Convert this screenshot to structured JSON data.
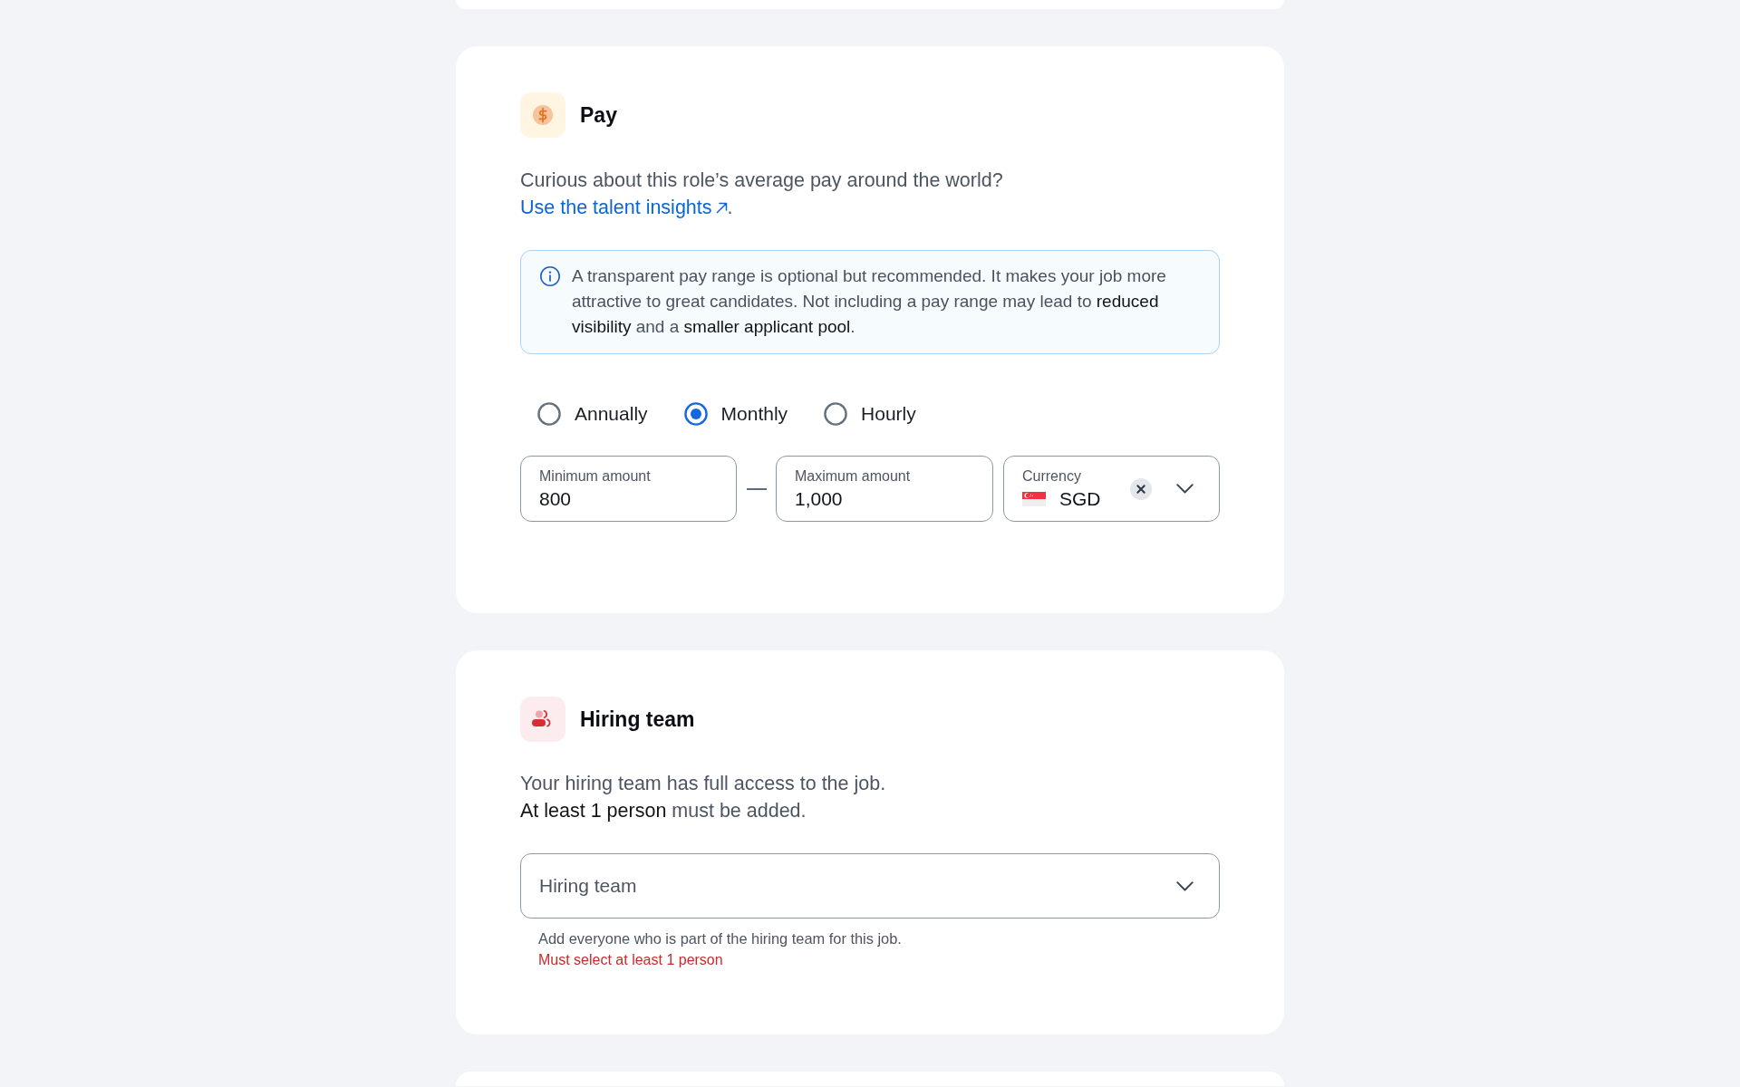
{
  "pay_section": {
    "title": "Pay",
    "description": "Curious about this role’s average pay around the world?",
    "insights_link": {
      "label": "Use the talent insights",
      "suffix": "."
    },
    "notice": "A transparent pay range is optional but recommended. It makes your job more attractive to great candidates. Not including a pay range may lead to **reduced visibility** and a **smaller applicant pool**.",
    "pay_period": [
      {
        "label": "Annually",
        "selected": false
      },
      {
        "label": "Monthly",
        "selected": true
      },
      {
        "label": "Hourly",
        "selected": false
      }
    ],
    "minimum_amount": {
      "label": "Minimum amount",
      "value": "800"
    },
    "maximum_amount": {
      "label": "Maximum amount",
      "value": "1,000"
    },
    "currency": {
      "label": "Currency",
      "value": "SGD"
    }
  },
  "hiring_team_section": {
    "title": "Hiring team",
    "description_lines": [
      "Your hiring team has full access to the job.",
      "**At least 1 person** must be added."
    ],
    "team_select": {
      "placeholder": "Hiring team"
    },
    "hint": "Add everyone who is part of the hiring team for this job.",
    "error": "Must select at least 1 person"
  }
}
